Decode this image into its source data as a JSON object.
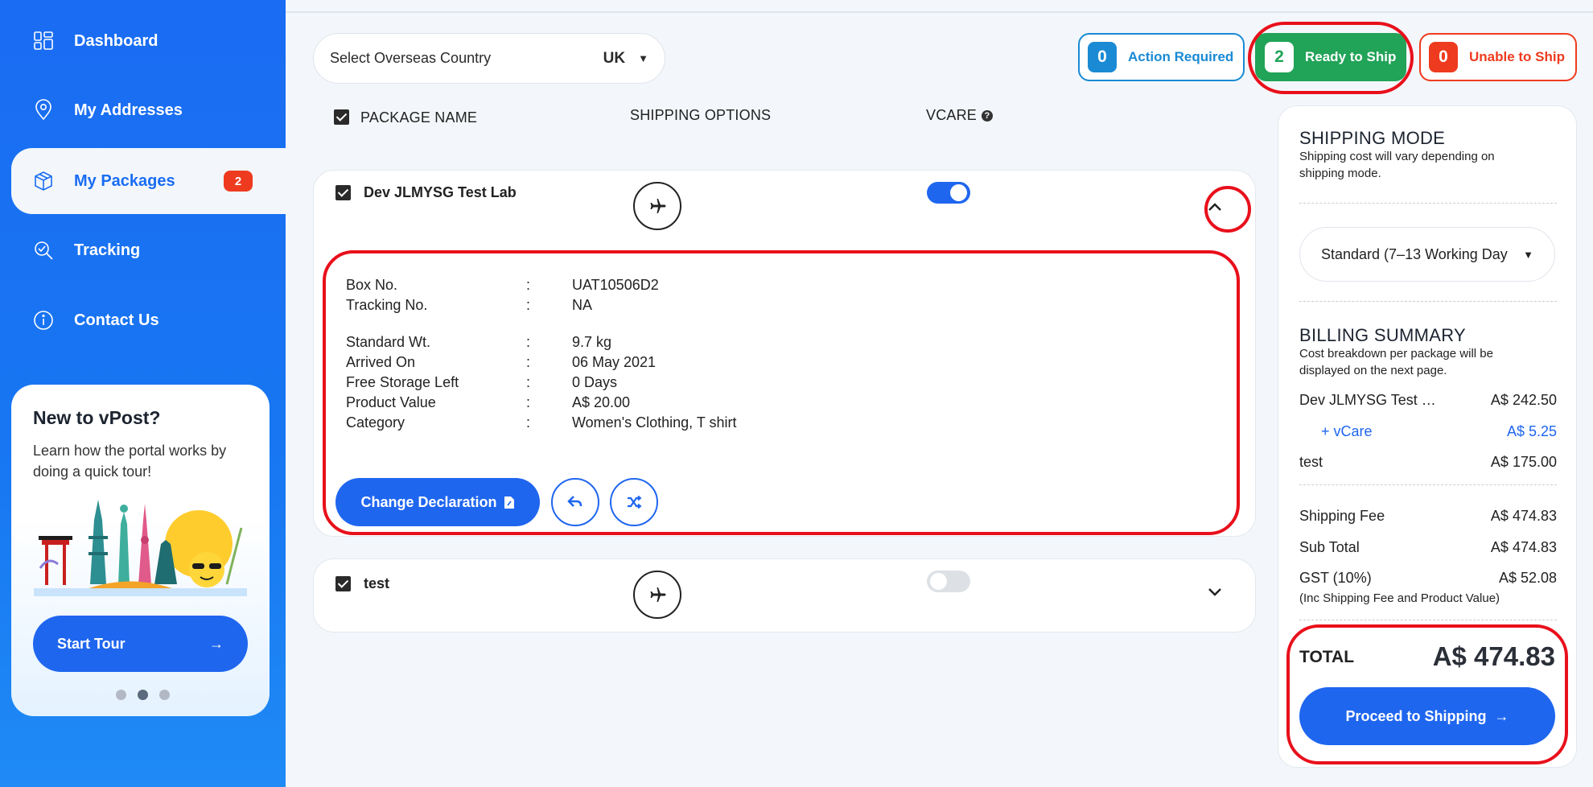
{
  "sidebar": {
    "items": [
      {
        "label": "Dashboard",
        "icon": "dashboard-icon"
      },
      {
        "label": "My Addresses",
        "icon": "location-pin-icon"
      },
      {
        "label": "My Packages",
        "icon": "package-box-icon",
        "badge": "2"
      },
      {
        "label": "Tracking",
        "icon": "tracking-search-icon"
      },
      {
        "label": "Contact Us",
        "icon": "info-icon"
      }
    ],
    "tour": {
      "title": "New to vPost?",
      "text": "Learn how the portal works by doing a quick tour!",
      "button": "Start Tour",
      "button_icon": "→"
    }
  },
  "country_select": {
    "placeholder": "Select Overseas Country",
    "value": "UK",
    "chevron": "⌄"
  },
  "status": {
    "action_required": {
      "count": "0",
      "label": "Action Required"
    },
    "ready_to_ship": {
      "count": "2",
      "label": "Ready to Ship"
    },
    "unable_to_ship": {
      "count": "0",
      "label": "Unable to Ship"
    }
  },
  "columns": {
    "package_name": "PACKAGE NAME",
    "shipping_options": "SHIPPING OPTIONS",
    "vcare": "VCARE"
  },
  "packages": [
    {
      "name": "Dev JLMYSG Test Lab",
      "vcare_on": true,
      "expanded": true,
      "details": [
        {
          "label": "Box No.",
          "value": "UAT10506D2"
        },
        {
          "label": "Tracking No.",
          "value": "NA"
        },
        {
          "label": "Standard Wt.",
          "value": "9.7 kg"
        },
        {
          "label": "Arrived On",
          "value": "06 May 2021"
        },
        {
          "label": "Free Storage Left",
          "value": "0 Days"
        },
        {
          "label": "Product Value",
          "value": "A$ 20.00"
        },
        {
          "label": "Category",
          "value": "Women's Clothing, T shirt"
        }
      ],
      "change_button": "Change Declaration"
    },
    {
      "name": "test",
      "vcare_on": false,
      "expanded": false
    }
  ],
  "summary": {
    "shipping_mode_title": "SHIPPING MODE",
    "shipping_mode_sub": "Shipping cost will vary depending on shipping mode.",
    "mode_value": "Standard (7–13 Working Day",
    "billing_title": "BILLING SUMMARY",
    "billing_sub": "Cost breakdown per package will be displayed on the next page.",
    "lines": [
      {
        "label": "Dev JLMYSG Test …",
        "value": "A$ 242.50"
      },
      {
        "label": "+ vCare",
        "value": "A$ 5.25"
      },
      {
        "label": "test",
        "value": "A$ 175.00"
      }
    ],
    "shipping_fee": {
      "label": "Shipping Fee",
      "value": "A$ 474.83"
    },
    "sub_total": {
      "label": "Sub Total",
      "value": "A$ 474.83"
    },
    "gst": {
      "label": "GST (10%)",
      "value": "A$ 52.08",
      "note": "(Inc Shipping Fee and Product Value)"
    },
    "total_label": "TOTAL",
    "total_value": "A$ 474.83",
    "proceed_button": "Proceed to Shipping",
    "proceed_icon": "→"
  },
  "colors": {
    "primary": "#1f66ef",
    "success": "#21a358",
    "danger": "#ee3b1f",
    "info": "#1a8ad4",
    "annotation": "#e8101b"
  }
}
